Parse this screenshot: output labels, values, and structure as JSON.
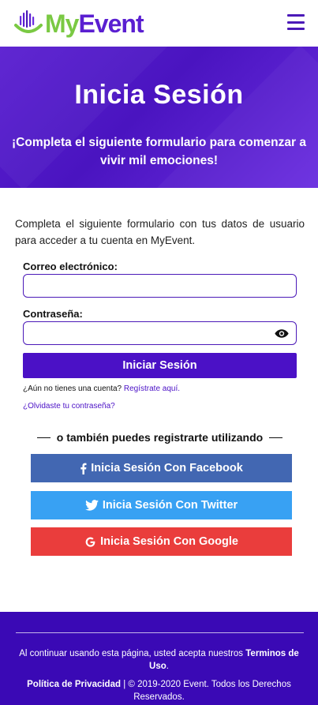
{
  "header": {
    "logo_my": "My",
    "logo_event": "Event"
  },
  "hero": {
    "title": "Inicia Sesión",
    "subtitle": "¡Completa el siguiente formulario para comenzar a vivir mil emociones!"
  },
  "form": {
    "intro": "Completa el siguiente formulario con tus datos de usuario para acceder a tu cuenta en MyEvent.",
    "email_label": "Correo electrónico:",
    "email_value": "",
    "password_label": "Contraseña:",
    "password_value": "",
    "submit_label": "Iniciar Sesión",
    "no_account_text": "¿Aún no tienes una cuenta?",
    "register_link": "Regístrate aquí.",
    "forgot_link": "¿Olvidaste tu contraseña?"
  },
  "social": {
    "divider_text": "o también puedes registrarte utilizando",
    "facebook_label": "Inicia Sesión Con Facebook",
    "twitter_label": "Inicia Sesión Con Twitter",
    "google_label": "Inicia Sesión Con Google",
    "icons": [
      "facebook-icon",
      "twitter-icon",
      "google-icon",
      "eye-icon",
      "menu-icon"
    ]
  },
  "footer": {
    "terms_prefix": "Al continuar usando esta página, usted acepta nuestros",
    "terms_link": "Terminos de Uso",
    "terms_suffix": ".",
    "privacy_link": "Política de Privacidad",
    "copyright": "| © 2019-2020 Event. Todos los Derechos Reservados."
  },
  "colors": {
    "primary": "#4b11c6",
    "accent_green": "#7ac943",
    "facebook": "#4267b2",
    "twitter": "#38a1f3",
    "google": "#ea3d3c",
    "footer_bg": "#3a09b5"
  }
}
